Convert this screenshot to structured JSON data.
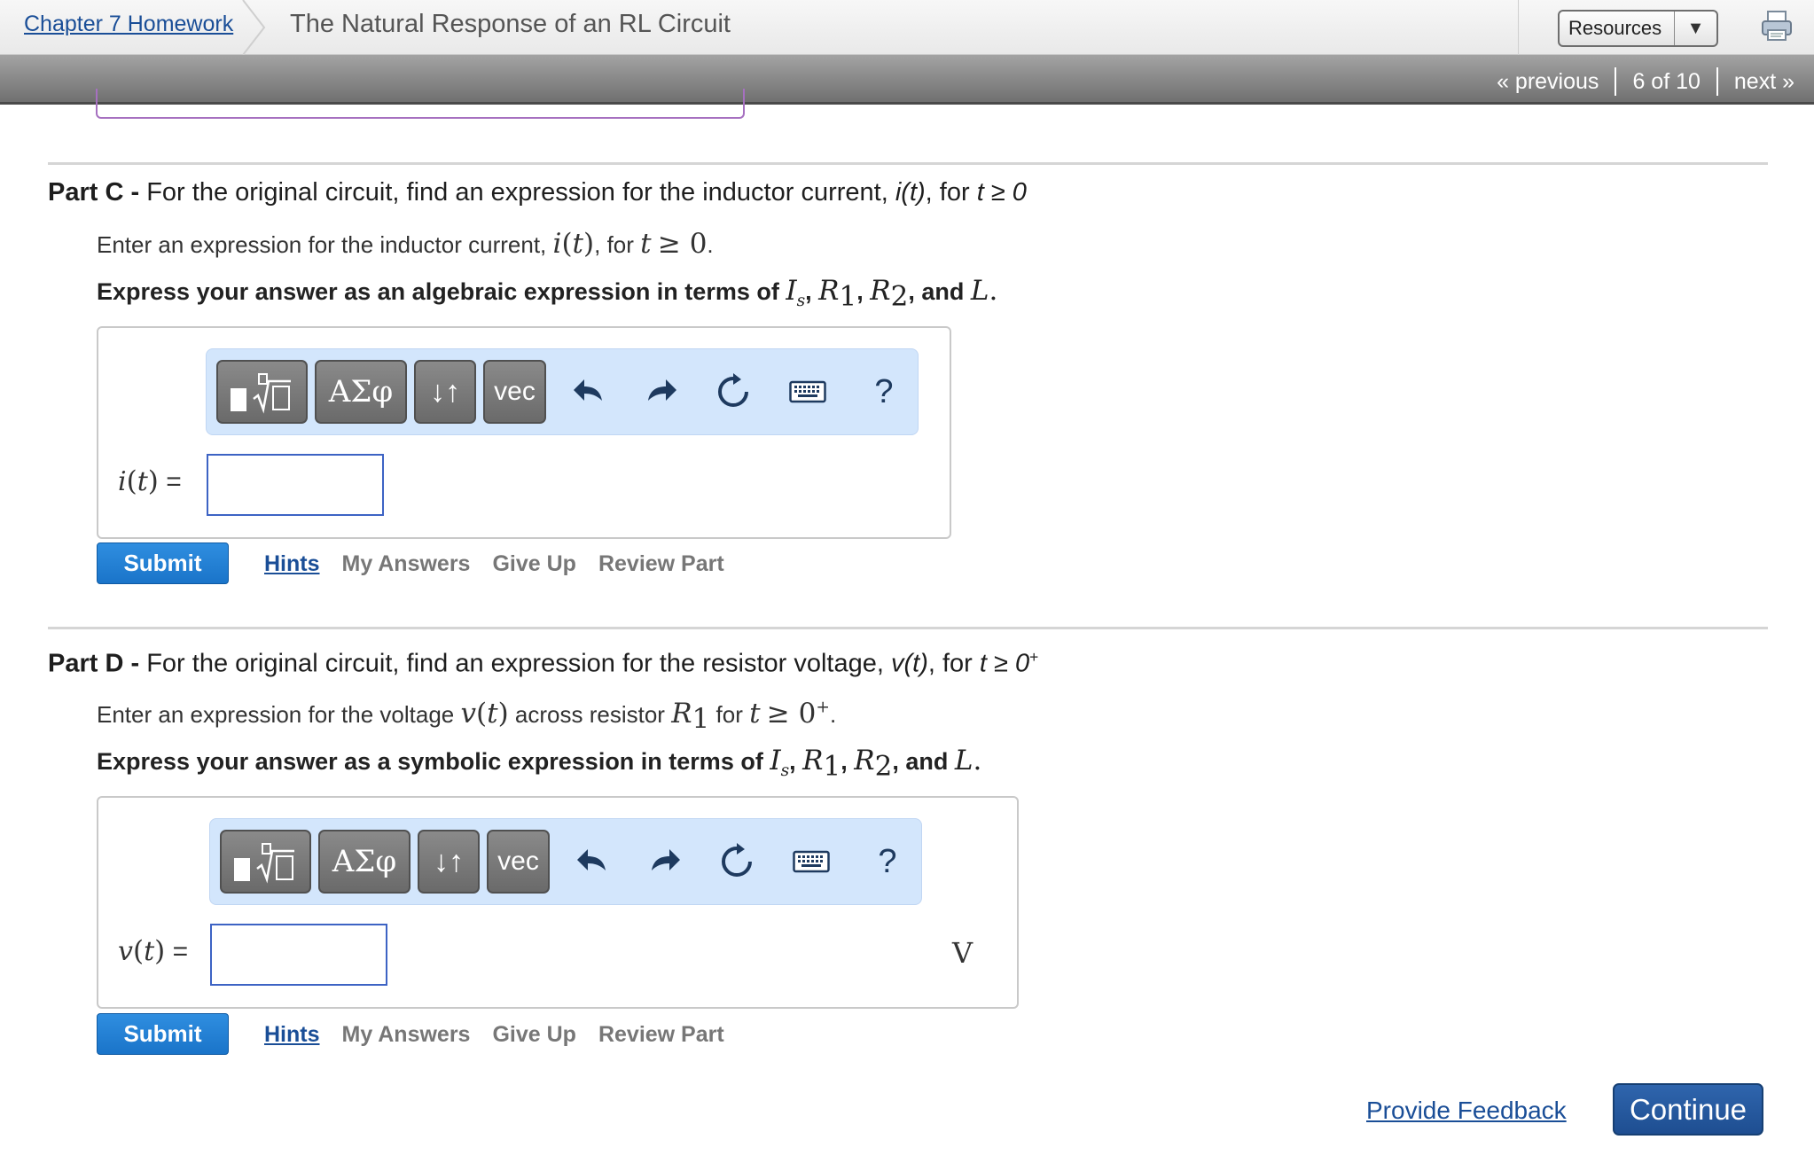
{
  "header": {
    "breadcrumb_link": "Chapter 7 Homework",
    "title": "The Natural Response of an RL Circuit",
    "resources_label": "Resources"
  },
  "nav": {
    "previous": "« previous",
    "position": "6 of 10",
    "next": "next »"
  },
  "toolbar": {
    "greek_label": "ΑΣφ",
    "arrows_label": "↓↑",
    "vec_label": "vec",
    "help_label": "?"
  },
  "part_c": {
    "part_label": "Part C -",
    "heading": "For the original circuit, find an expression for the inductor current,",
    "heading_var": "i(t)",
    "heading_cond_for": ", for",
    "heading_cond": "t ≥ 0",
    "instruction_text": "Enter an expression for the inductor current,",
    "instruction_for": ", for",
    "instruction_end": ".",
    "express_text": "Express your answer as an algebraic expression in terms of",
    "and_text": ", and",
    "answer_label": "=",
    "answer_value": ""
  },
  "part_d": {
    "part_label": "Part D -",
    "heading": "For the original circuit, find an expression for the resistor voltage,",
    "heading_var": "v(t)",
    "heading_cond_for": ", for",
    "heading_cond": "t ≥ 0",
    "heading_sup": "+",
    "instruction_text": "Enter an expression for the voltage",
    "instruction_mid": "across resistor",
    "instruction_for": "for",
    "instruction_end": ".",
    "express_text": "Express your answer as a symbolic expression in terms of",
    "and_text": ", and",
    "answer_label": "=",
    "answer_value": "",
    "unit": "V"
  },
  "actions": {
    "submit": "Submit",
    "hints": "Hints",
    "my_answers": "My Answers",
    "give_up": "Give Up",
    "review_part": "Review Part"
  },
  "footer": {
    "feedback": "Provide Feedback",
    "continue": "Continue"
  },
  "colors": {
    "link": "#1a4e97",
    "submit": "#1a74c9",
    "toolbar_bg": "#d3e6fc",
    "input_border": "#3d63c4",
    "continue": "#1e4e91"
  }
}
